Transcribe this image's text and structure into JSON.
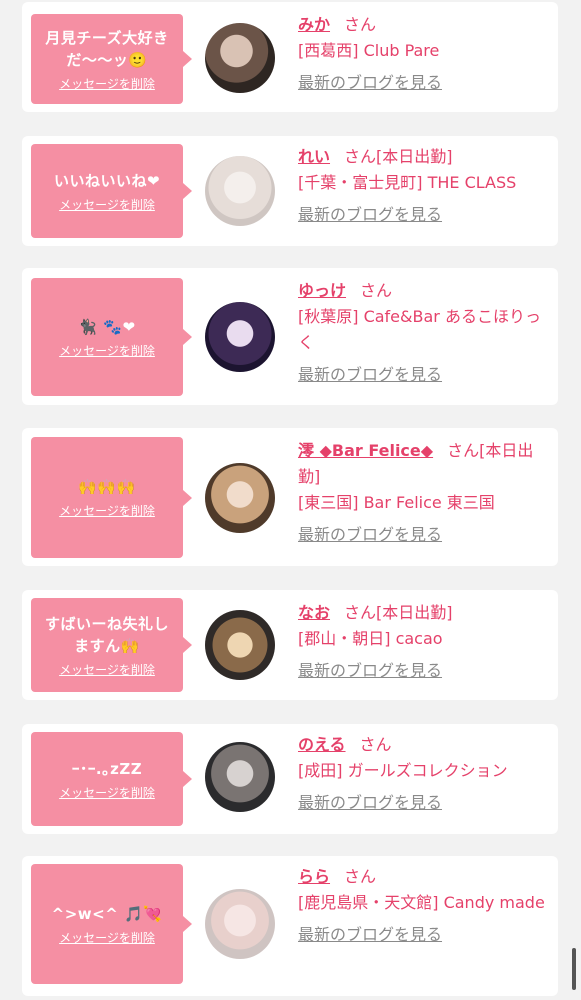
{
  "delete_label": "メッセージを削除",
  "blog_label": "最新のブログを見る",
  "entries": [
    {
      "message": "月見チーズ大好きだ〜〜ッ🙂",
      "name": "みか",
      "suffix": "さん",
      "shop": "[西葛西] Club Pare"
    },
    {
      "message": "いいねいいね❤",
      "name": "れい",
      "suffix": "さん[本日出勤]",
      "shop": "[千葉・富士見町] THE CLASS"
    },
    {
      "message": "🐈‍⬛ 🐾❤",
      "name": "ゆっけ",
      "suffix": "さん",
      "shop": "[秋葉原] Cafe&Bar あるこほりっく"
    },
    {
      "message": "🙌🙌🙌",
      "name": "澪 ◆Bar Felice◆",
      "suffix": "さん[本日出勤]",
      "shop": "[東三国] Bar Felice 東三国"
    },
    {
      "message": "すばいーね失礼しますん🙌",
      "name": "なお",
      "suffix": "さん[本日出勤]",
      "shop": "[郡山・朝日] cacao"
    },
    {
      "message": "ｰ･ｰ.｡zZZ",
      "name": "のえる",
      "suffix": "さん",
      "shop": "[成田] ガールズコレクション"
    },
    {
      "message": "^>w<^ 🎵💘",
      "name": "らら",
      "suffix": "さん",
      "shop": "[鹿児島県・天文館] Candy made"
    }
  ]
}
